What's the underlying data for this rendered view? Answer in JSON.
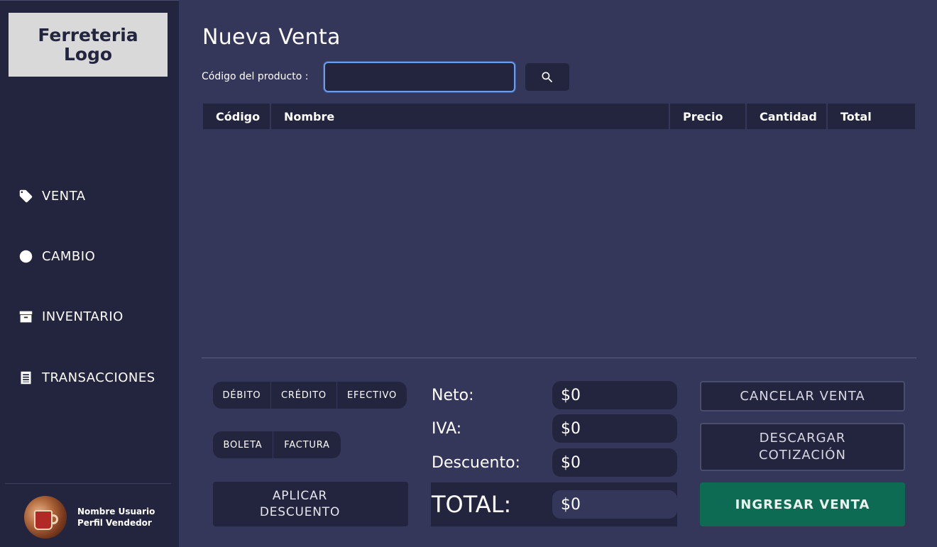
{
  "sidebar": {
    "logo": "Ferreteria\nLogo",
    "items": [
      {
        "label": "VENTA",
        "icon": "tag-icon"
      },
      {
        "label": "CAMBIO",
        "icon": "exchange-icon"
      },
      {
        "label": "INVENTARIO",
        "icon": "archive-icon"
      },
      {
        "label": "TRANSACCIONES",
        "icon": "receipt-icon"
      }
    ],
    "user": {
      "name": "Nombre Usuario",
      "role": "Perfil Vendedor"
    }
  },
  "main": {
    "title": "Nueva Venta",
    "code_label": "Código del producto :",
    "code_value": "",
    "table": {
      "columns": [
        "Código",
        "Nombre",
        "Precio",
        "Cantidad",
        "Total"
      ],
      "rows": []
    },
    "payment_methods": [
      "DÉBITO",
      "CRÉDITO",
      "EFECTIVO"
    ],
    "document_types": [
      "BOLETA",
      "FACTURA"
    ],
    "discount_button": "APLICAR\nDESCUENTO",
    "summary": {
      "neto_label": "Neto:",
      "neto_value": "$0",
      "iva_label": "IVA:",
      "iva_value": "$0",
      "descuento_label": "Descuento:",
      "descuento_value": "$0",
      "total_label": "TOTAL:",
      "total_value": "$0"
    },
    "actions": {
      "cancel": "CANCELAR VENTA",
      "download": "DESCARGAR\nCOTIZACIÓN",
      "submit": "INGRESAR VENTA"
    }
  },
  "colors": {
    "sidebar_bg": "#23253f",
    "main_bg": "#35375a",
    "accent_green": "#0e6b53",
    "input_focus": "#6c9be8"
  }
}
